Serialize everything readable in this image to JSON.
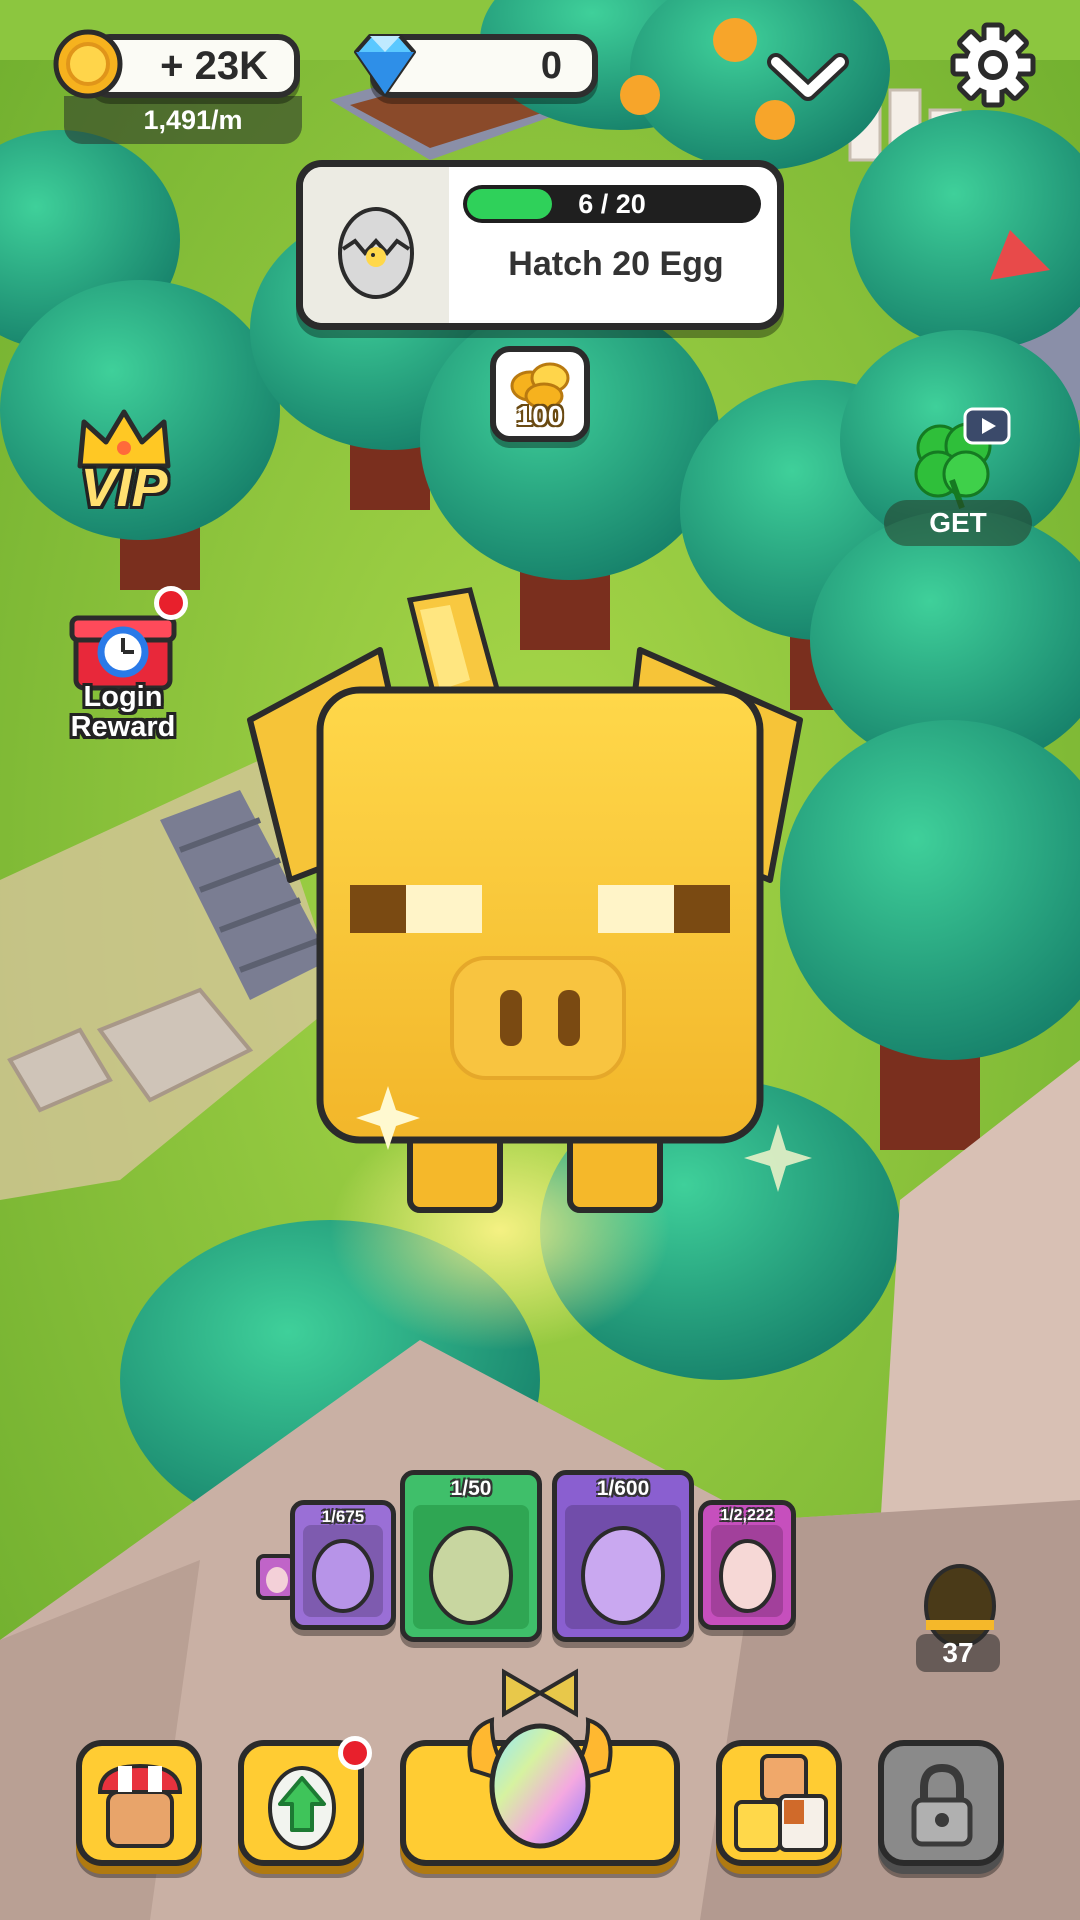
{
  "hud": {
    "coins": "+ 23K",
    "coin_rate": "1,491/m",
    "gems": "0"
  },
  "quest": {
    "progress_text": "6 / 20",
    "progress_fraction": 0.3,
    "title": "Hatch 20 Egg",
    "reward_amount": "100"
  },
  "side_buttons": {
    "vip_label": "VIP",
    "login_reward_label": "Login Reward",
    "clover_label": "GET"
  },
  "eggs": [
    {
      "count": "1/675",
      "color": "#9a6fd6"
    },
    {
      "count": "1/50",
      "color": "#3fbf6a",
      "selected": true
    },
    {
      "count": "1/600",
      "color": "#8a5fd0"
    },
    {
      "count": "1/2,222",
      "color": "#c64fbd"
    }
  ],
  "egg_stock": "37",
  "nav": {
    "shop_icon": "shop-stall-icon",
    "upgrade_icon": "upgrade-egg-icon",
    "hatch_icon": "rainbow-egg-icon",
    "pets_icon": "pets-icon",
    "locked_icon": "padlock-icon"
  },
  "colors": {
    "progress": "#2fd15a",
    "button_yellow": "#ffcc33",
    "badge_red": "#e8202c"
  }
}
